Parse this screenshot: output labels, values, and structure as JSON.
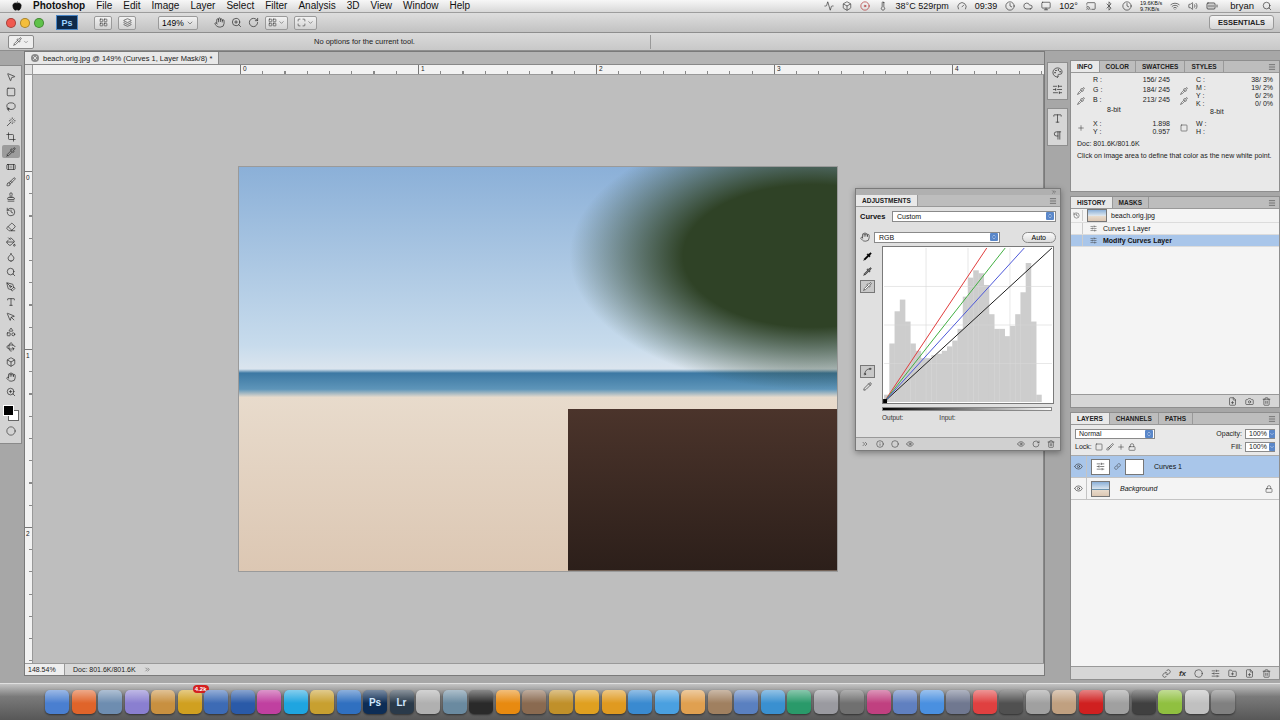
{
  "menubar": {
    "app": "Photoshop",
    "menus": [
      "File",
      "Edit",
      "Image",
      "Layer",
      "Select",
      "Filter",
      "Analysis",
      "3D",
      "View",
      "Window",
      "Help"
    ],
    "status": {
      "temp": "38°C 529rpm",
      "time": "09:39",
      "cpu": "102°",
      "net_up": "19.6KB/s",
      "net_down": "9.7KB/s",
      "user": "bryan"
    }
  },
  "appbar": {
    "logo": "Ps",
    "zoom": "149%",
    "workspace": "ESSENTIALS"
  },
  "options_bar": {
    "message": "No options for the current tool."
  },
  "tools": [
    {
      "selected": false
    },
    {
      "selected": false
    },
    {
      "selected": false
    },
    {
      "selected": false
    },
    {
      "selected": false
    },
    {
      "selected": true
    },
    {
      "selected": false
    },
    {
      "selected": false
    },
    {
      "selected": false
    },
    {
      "selected": false
    },
    {
      "selected": false
    },
    {
      "selected": false
    },
    {
      "selected": false
    },
    {
      "selected": false
    },
    {
      "selected": false
    },
    {
      "selected": false
    },
    {
      "selected": false
    },
    {
      "selected": false
    },
    {
      "selected": false
    },
    {
      "selected": false
    },
    {
      "selected": false
    },
    {
      "selected": false
    }
  ],
  "document": {
    "tab": "beach.orig.jpg @ 149% (Curves 1, Layer Mask/8) *",
    "top_ruler": [
      "0",
      "1",
      "2",
      "3",
      "4"
    ],
    "left_ruler": [
      "0",
      "1",
      "2"
    ],
    "status": {
      "zoom": "148.54%",
      "doc": "Doc: 801.6K/801.6K"
    }
  },
  "adjustments": {
    "title": "ADJUSTMENTS",
    "type": "Curves",
    "preset": "Custom",
    "channel": "RGB",
    "auto": "Auto",
    "output_label": "Output:",
    "input_label": "Input:",
    "tools": [
      {
        "selected": false
      },
      {
        "selected": false
      },
      {
        "selected": true
      },
      {
        "selected": true
      },
      {
        "selected": false
      }
    ],
    "histogram": [
      0.05,
      0.4,
      0.62,
      0.7,
      0.55,
      0.4,
      0.35,
      0.3,
      0.3,
      0.32,
      0.33,
      0.35,
      0.38,
      0.42,
      0.5,
      0.72,
      0.85,
      0.9,
      0.88,
      0.8,
      0.6,
      0.5,
      0.5,
      0.45,
      0.52,
      0.6,
      0.75,
      0.95,
      0.55,
      0.05,
      0,
      0
    ],
    "curves": [
      {
        "channel": "RGB",
        "color": "#1a1a1a",
        "points": [
          [
            0,
            0
          ],
          [
            255,
            255
          ]
        ]
      },
      {
        "channel": "Red",
        "color": "#e03a3a",
        "points": [
          [
            0,
            0
          ],
          [
            156,
            255
          ]
        ]
      },
      {
        "channel": "Green",
        "color": "#3fae3f",
        "points": [
          [
            0,
            0
          ],
          [
            184,
            255
          ]
        ]
      },
      {
        "channel": "Blue",
        "color": "#4a55d8",
        "points": [
          [
            0,
            0
          ],
          [
            213,
            255
          ]
        ]
      }
    ]
  },
  "info": {
    "tabs": [
      {
        "label": "INFO",
        "selected": true
      },
      {
        "label": "COLOR",
        "selected": false
      },
      {
        "label": "SWATCHES",
        "selected": false
      },
      {
        "label": "STYLES",
        "selected": false
      }
    ],
    "rgb": [
      {
        "label": "R :",
        "value": "156/ 245"
      },
      {
        "label": "G :",
        "value": "184/ 245"
      },
      {
        "label": "B :",
        "value": "213/ 245"
      }
    ],
    "rgb_depth": "8-bit",
    "cmyk": [
      {
        "label": "C :",
        "value": "38/ 3%"
      },
      {
        "label": "M :",
        "value": "19/ 2%"
      },
      {
        "label": "Y :",
        "value": "6/ 2%"
      },
      {
        "label": "K :",
        "value": "0/ 0%"
      }
    ],
    "cmyk_depth": "8-bit",
    "position": [
      {
        "label": "X :",
        "value": "1.898"
      },
      {
        "label": "Y :",
        "value": "0.957"
      }
    ],
    "size": [
      {
        "label": "W :"
      },
      {
        "label": "H :"
      }
    ],
    "doc": "Doc: 801.6K/801.6K",
    "hint": "Click on image area to define that color as the new white point."
  },
  "history": {
    "tabs": [
      {
        "label": "HISTORY",
        "selected": true
      },
      {
        "label": "MASKS",
        "selected": false
      }
    ],
    "snapshot": "beach.orig.jpg",
    "items": [
      {
        "label": "Curves 1 Layer",
        "selected": false
      },
      {
        "label": "Modify Curves Layer",
        "selected": true
      }
    ]
  },
  "layers": {
    "tabs": [
      {
        "label": "LAYERS",
        "selected": true
      },
      {
        "label": "CHANNELS",
        "selected": false
      },
      {
        "label": "PATHS",
        "selected": false
      }
    ],
    "blend": "Normal",
    "opacity_label": "Opacity:",
    "opacity": "100%",
    "lock_label": "Lock:",
    "fill_label": "Fill:",
    "fill": "100%",
    "fx_label": "fx",
    "items": [
      {
        "name": "Curves 1",
        "kind": "adjustment",
        "selected": true,
        "visible": true,
        "locked": false
      },
      {
        "name": "Background",
        "kind": "image",
        "selected": false,
        "visible": true,
        "locked": true
      }
    ]
  },
  "dock": {
    "apps": [
      {
        "color": "#4a7fd0"
      },
      {
        "color": "#e0642a"
      },
      {
        "color": "#6e8db0"
      },
      {
        "color": "#8a7fd0"
      },
      {
        "color": "#c89040"
      },
      {
        "color": "#d0a020",
        "badge": "4.2k"
      },
      {
        "color": "#3d6bb5"
      },
      {
        "color": "#2a5aa8"
      },
      {
        "color": "#c040a0"
      },
      {
        "color": "#1fa5e0"
      },
      {
        "color": "#c8a030"
      },
      {
        "color": "#3070c0"
      },
      {
        "color": "#0d2d56",
        "label": "Ps"
      },
      {
        "color": "#2a3a4a",
        "label": "Lr"
      },
      {
        "color": "#b0b0b0"
      },
      {
        "color": "#6a8aa0"
      },
      {
        "color": "#2a2a2a"
      },
      {
        "color": "#e88a10"
      },
      {
        "color": "#8a6a50"
      },
      {
        "color": "#c0902a"
      },
      {
        "color": "#e0a020"
      },
      {
        "color": "#e09a20"
      },
      {
        "color": "#3a8ad0"
      },
      {
        "color": "#4aa0e0"
      },
      {
        "color": "#e0a050"
      },
      {
        "color": "#a08060"
      },
      {
        "color": "#5a80c0"
      },
      {
        "color": "#3a90d0"
      },
      {
        "color": "#2a9a6a"
      },
      {
        "color": "#9a9aa0"
      },
      {
        "color": "#707070"
      },
      {
        "color": "#c04080"
      },
      {
        "color": "#6080c0"
      },
      {
        "color": "#4a90e0"
      },
      {
        "color": "#707890"
      },
      {
        "color": "#e04040"
      },
      {
        "color": "#505050"
      },
      {
        "color": "#a0a0a0"
      },
      {
        "color": "#c0a080"
      },
      {
        "color": "#d02020"
      },
      {
        "color": "#a0a0a0"
      },
      {
        "color": "#404040"
      },
      {
        "color": "#90c040"
      },
      {
        "color": "#c0c0c0"
      },
      {
        "color": "#808080"
      }
    ]
  }
}
